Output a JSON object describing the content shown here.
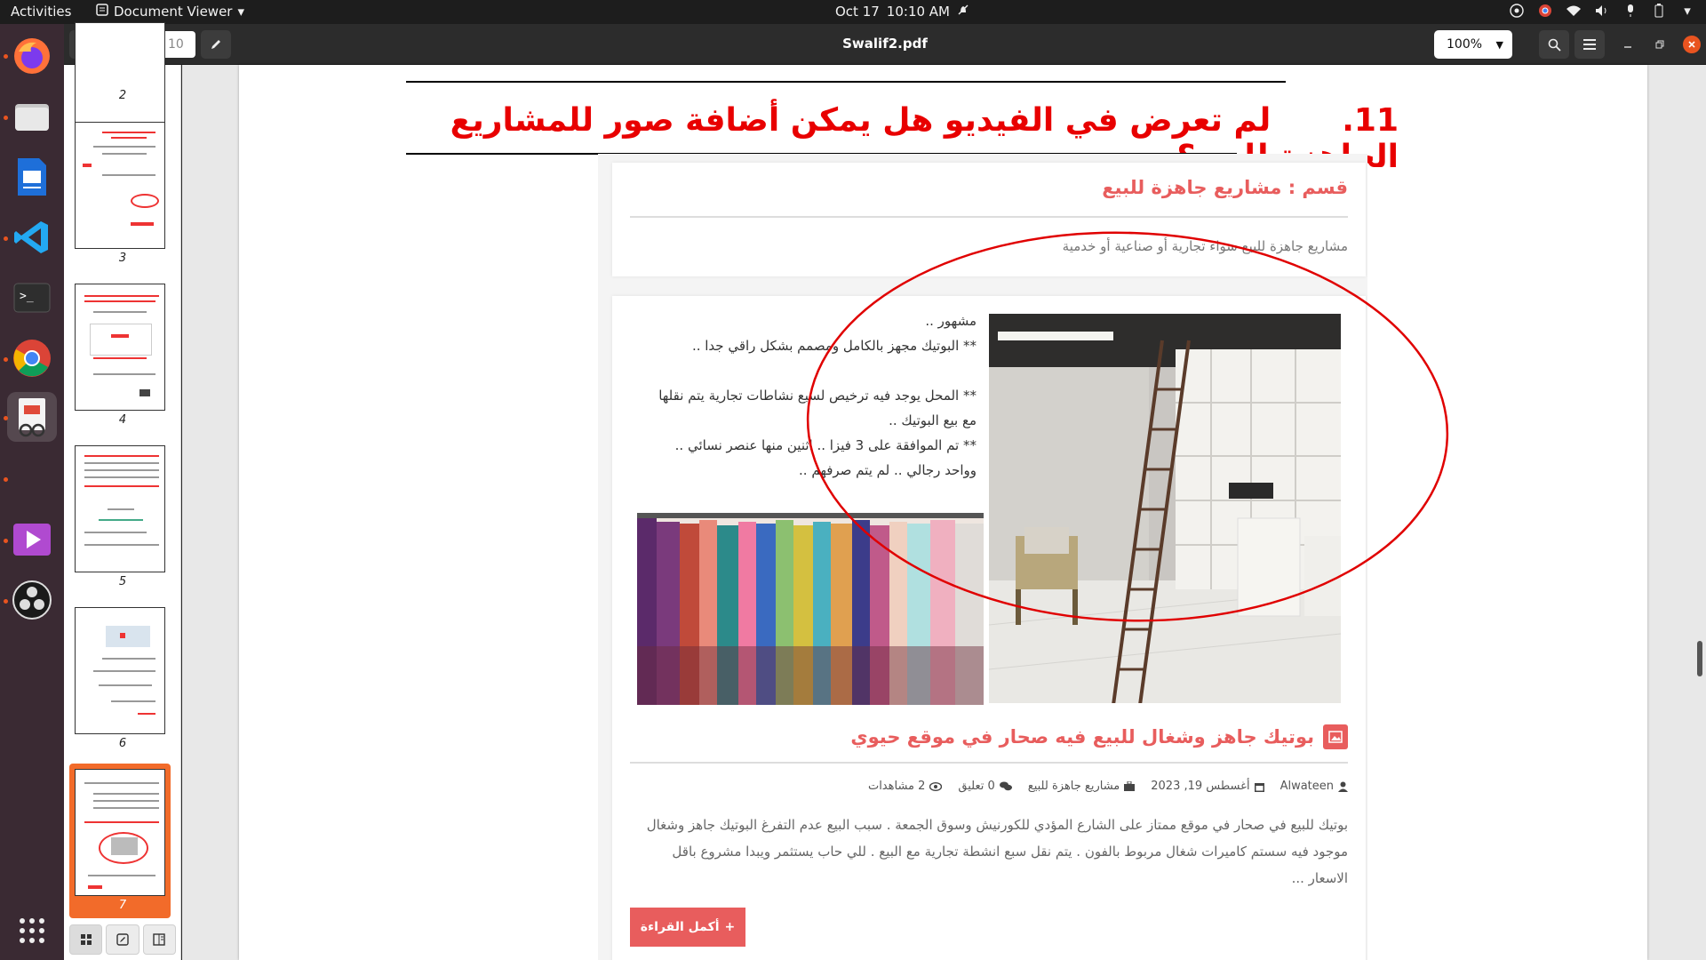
{
  "topbar": {
    "activities": "Activities",
    "app_name": "Document Viewer",
    "date": "Oct 17",
    "time": "10:10 AM"
  },
  "dock": {
    "apps": [
      "firefox",
      "files",
      "libreoffice-writer",
      "vscode",
      "terminal",
      "chrome",
      "document-viewer",
      "media-player",
      "obs-studio",
      "show-applications"
    ]
  },
  "header": {
    "page_current": "7",
    "page_of": "of 10",
    "title": "Swalif2.pdf",
    "zoom": "100%"
  },
  "sidebar": {
    "thumbnails": [
      {
        "label": "2"
      },
      {
        "label": "3"
      },
      {
        "label": "4"
      },
      {
        "label": "5"
      },
      {
        "label": "6"
      },
      {
        "label": "7",
        "selected": true
      }
    ]
  },
  "document": {
    "question_number": ".11",
    "question_text": "لم تعرض في الفيديو هل يمكن أضافة صور للمشاريع الجاهزة للبيع؟",
    "category_title": "قسم : مشاريع جاهزة للبيع",
    "category_desc": "مشاريع جاهزة للبيع سواء تجارية أو صناعية أو خدمية",
    "post_lines": [
      "مشهور ..",
      "** البوتيك مجهز بالكامل ومصمم بشكل راقي جدا ..",
      "",
      "** المحل يوجد فيه ترخيص لسبع نشاطات تجارية يتم نقلها مع بيع البوتيك ..",
      "** تم الموافقة على 3 فيزا .. اثنين منها عنصر نسائي .. وواحد رجالي .. لم يتم صرفهم .."
    ],
    "post_title": "بوتيك جاهز وشغال للبيع فيه صحار في موقع حيوي",
    "meta": {
      "author": "Alwateen",
      "date": "أغسطس 19, 2023",
      "category": "مشاريع جاهزة للبيع",
      "comments": "0 تعليق",
      "views": "2 مشاهدات"
    },
    "excerpt": "بوتيك للبيع في صحار في موقع ممتاز على الشارع المؤدي للكورنيش وسوق الجمعة . سبب البيع عدم التفرغ البوتيك جاهز وشغال موجود فيه سستم كاميرات شغال مربوط بالفون . يتم نقل سبع انشطة تجارية مع البيع . للي حاب يستثمر ويبدا مشروع باقل الاسعار ...",
    "read_more": "أكمل القراءة"
  },
  "colors": {
    "accent": "#e95420",
    "question_red": "#e80000",
    "site_red": "#e85d5d",
    "annotation_ellipse": "#e00000"
  }
}
